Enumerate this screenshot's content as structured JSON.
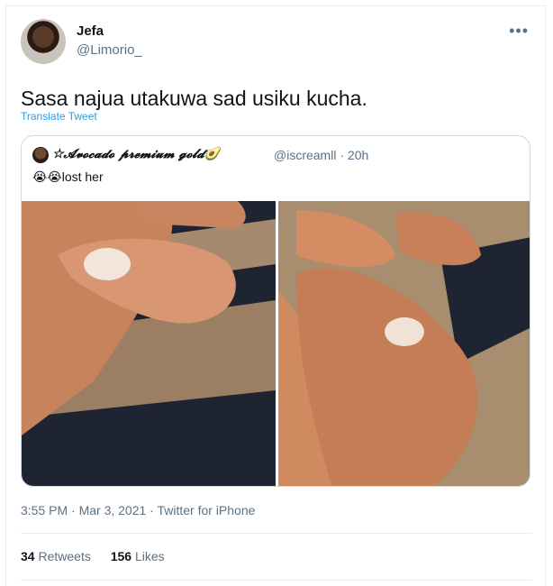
{
  "tweet": {
    "author_name": "Jefa",
    "author_handle": "@Limorio_",
    "more_icon": "more-icon",
    "text": "Sasa najua utakuwa sad usiku kucha.",
    "translate_label": "Translate Tweet",
    "timestamp": "3:55 PM · Mar 3, 2021 · Twitter for iPhone"
  },
  "quoted": {
    "name": "☆𝓐𝓿𝓸𝓬𝓪𝓭𝓸 𝓹𝓻𝓮𝓶𝓲𝓾𝓶 𝓰𝓸𝓵𝓭🥑",
    "handle": "@iscreamll",
    "separator": "·",
    "age": "20h",
    "text": "😭😭lost her"
  },
  "stats": {
    "retweets_count": "34",
    "retweets_label": "Retweets",
    "likes_count": "156",
    "likes_label": "Likes"
  },
  "colors": {
    "link_blue": "#1da1f2",
    "secondary_text": "#5b7083",
    "border": "#e6ecf0"
  }
}
